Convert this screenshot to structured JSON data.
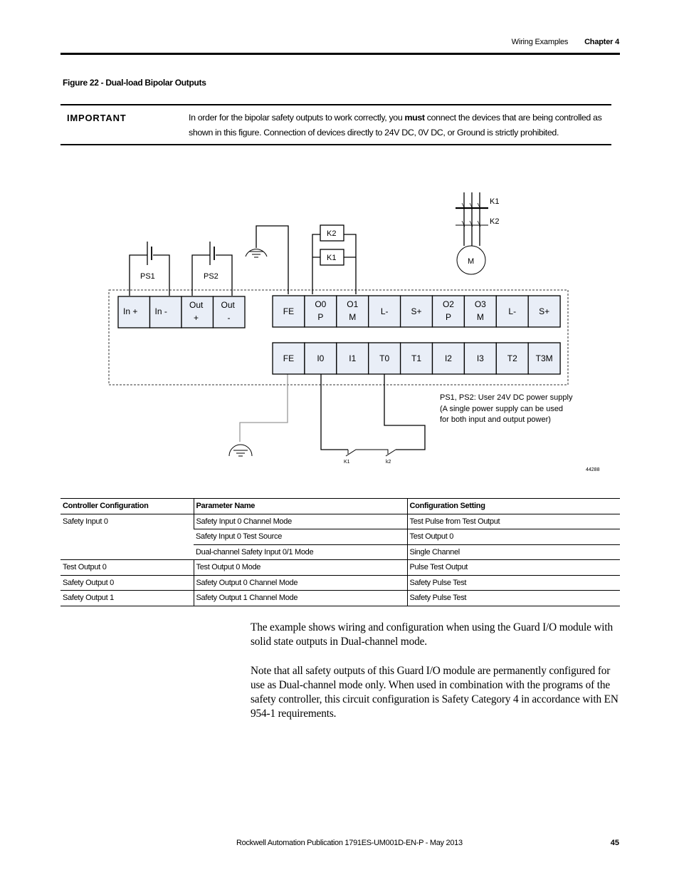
{
  "header": {
    "section": "Wiring Examples",
    "chapter": "Chapter 4"
  },
  "figure": {
    "title": "Figure 22 - Dual-load Bipolar Outputs",
    "id_number": "44288"
  },
  "important": {
    "label": "IMPORTANT",
    "text_before": "In order for the bipolar safety outputs to work correctly, you ",
    "text_bold": "must",
    "text_after": " connect the devices that are being controlled as shown in this figure. Connection of devices directly to 24V DC, 0V DC, or Ground is strictly prohibited."
  },
  "diagram": {
    "power_terminals": [
      {
        "line1": "In +",
        "line2": ""
      },
      {
        "line1": "In -",
        "line2": ""
      },
      {
        "line1": "Out",
        "line2": "+"
      },
      {
        "line1": "Out",
        "line2": "-"
      }
    ],
    "output_terminals": [
      {
        "line1": "FE",
        "line2": ""
      },
      {
        "line1": "O0",
        "line2": "P"
      },
      {
        "line1": "O1",
        "line2": "M"
      },
      {
        "line1": "L-",
        "line2": ""
      },
      {
        "line1": "S+",
        "line2": ""
      },
      {
        "line1": "O2",
        "line2": "P"
      },
      {
        "line1": "O3",
        "line2": "M"
      },
      {
        "line1": "L-",
        "line2": ""
      },
      {
        "line1": "S+",
        "line2": ""
      }
    ],
    "input_terminals": [
      "FE",
      "I0",
      "I1",
      "T0",
      "T1",
      "I2",
      "I3",
      "T2",
      "T3M"
    ],
    "power_supplies": [
      "PS1",
      "PS2"
    ],
    "relay_coils": [
      "K2",
      "K1"
    ],
    "motor_contacts": [
      "K1",
      "K2"
    ],
    "motor_label": "M",
    "feedback_contacts": [
      "K1",
      "k2"
    ],
    "note_lines": [
      "PS1, PS2: User 24V DC power supply",
      "(A single power supply can be used",
      "for both input and output power)"
    ],
    "terminal_fill": "#e9eef7"
  },
  "config_table": {
    "headers": [
      "Controller Configuration",
      "Parameter Name",
      "Configuration Setting"
    ],
    "groups": [
      {
        "controller": "Safety Input 0",
        "rows": [
          {
            "parameter": "Safety Input 0 Channel Mode",
            "setting": "Test Pulse from Test Output"
          },
          {
            "parameter": "Safety Input 0 Test Source",
            "setting": "Test Output 0"
          },
          {
            "parameter": "Dual-channel Safety Input 0/1 Mode",
            "setting": "Single Channel"
          }
        ]
      },
      {
        "controller": "Test Output 0",
        "rows": [
          {
            "parameter": "Test Output 0 Mode",
            "setting": "Pulse Test Output"
          }
        ]
      },
      {
        "controller": "Safety Output 0",
        "rows": [
          {
            "parameter": "Safety Output 0 Channel Mode",
            "setting": "Safety Pulse Test"
          }
        ]
      },
      {
        "controller": "Safety Output 1",
        "rows": [
          {
            "parameter": "Safety Output 1 Channel Mode",
            "setting": "Safety Pulse Test"
          }
        ]
      }
    ]
  },
  "body": {
    "paragraphs": [
      "The example shows wiring and configuration when using the Guard I/O module with solid state outputs in Dual-channel mode.",
      "Note that all safety outputs of this Guard I/O module are permanently configured for use as Dual-channel mode only. When used in combination with the programs of the safety controller, this circuit configuration is Safety Category 4 in accordance with EN 954-1 requirements."
    ]
  },
  "footer": {
    "publication": "Rockwell Automation Publication 1791ES-UM001D-EN-P - May 2013",
    "page_number": "45"
  }
}
